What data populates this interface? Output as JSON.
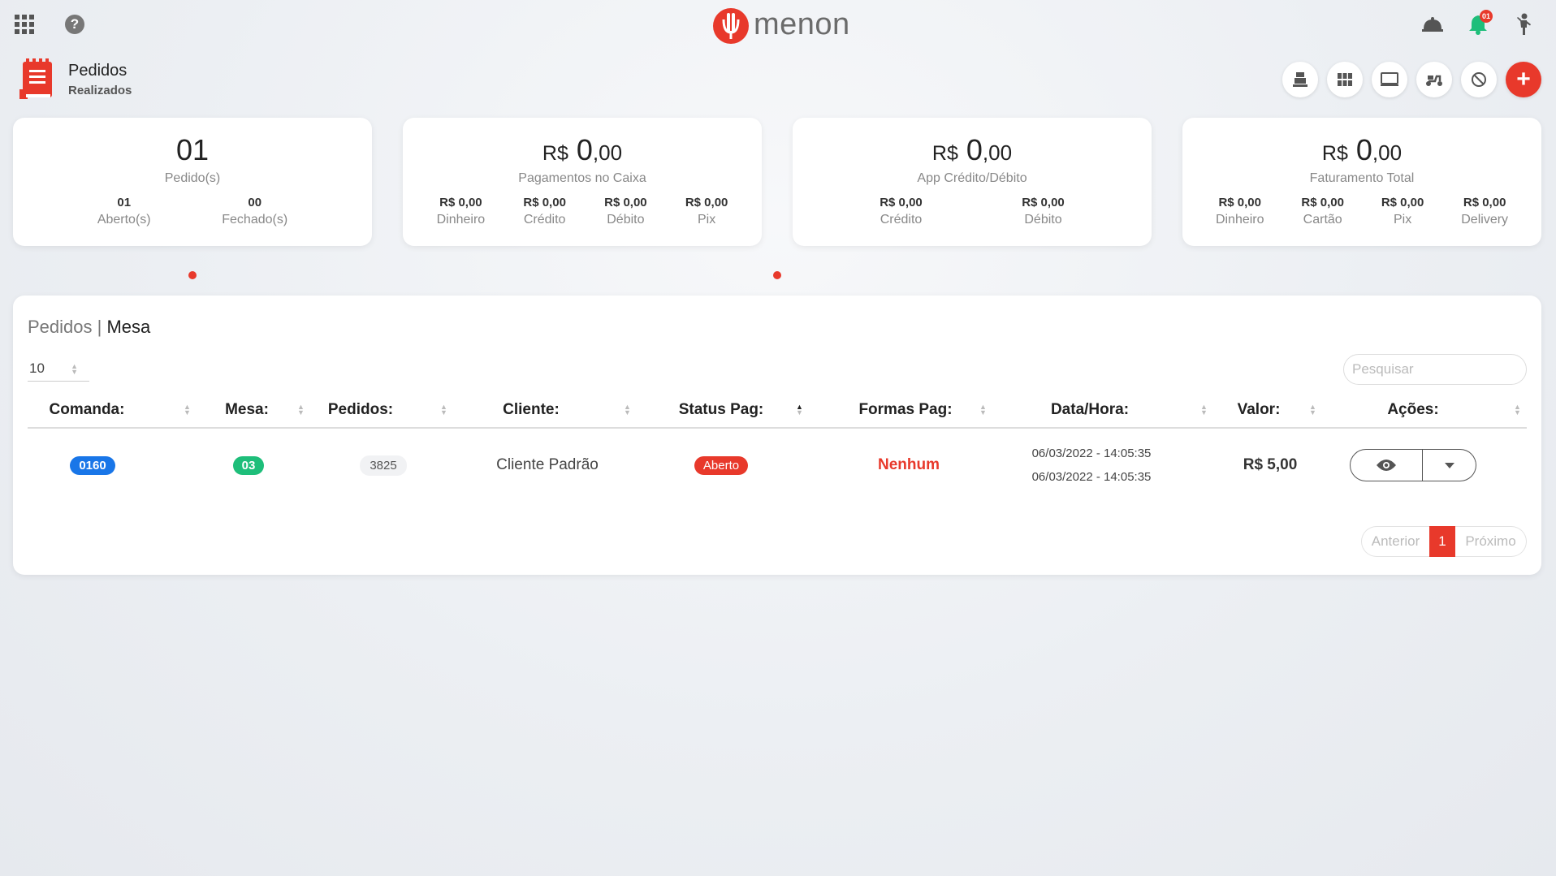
{
  "topbar": {
    "logo_text": "menon",
    "notification_count": "01",
    "icons": [
      "apps-grid-icon",
      "help-icon",
      "cloche-icon",
      "bell-icon",
      "person-icon"
    ]
  },
  "page": {
    "title": "Pedidos",
    "subtitle": "Realizados"
  },
  "colors": {
    "accent": "#e8392b",
    "blue": "#1976e8",
    "green": "#1ebe7a"
  },
  "cards": [
    {
      "main": "01",
      "label": "Pedido(s)",
      "subs": [
        {
          "value": "01",
          "label": "Aberto(s)"
        },
        {
          "value": "00",
          "label": "Fechado(s)"
        }
      ]
    },
    {
      "currency": "R$",
      "integer": "0",
      "decimal": ",00",
      "label": "Pagamentos no Caixa",
      "subs": [
        {
          "value": "R$ 0,00",
          "label": "Dinheiro"
        },
        {
          "value": "R$ 0,00",
          "label": "Crédito"
        },
        {
          "value": "R$ 0,00",
          "label": "Débito"
        },
        {
          "value": "R$ 0,00",
          "label": "Pix"
        }
      ]
    },
    {
      "currency": "R$",
      "integer": "0",
      "decimal": ",00",
      "label": "App Crédito/Débito",
      "subs": [
        {
          "value": "R$ 0,00",
          "label": "Crédito"
        },
        {
          "value": "R$ 0,00",
          "label": "Débito"
        }
      ]
    },
    {
      "currency": "R$",
      "integer": "0",
      "decimal": ",00",
      "label": "Faturamento Total",
      "subs": [
        {
          "value": "R$ 0,00",
          "label": "Dinheiro"
        },
        {
          "value": "R$ 0,00",
          "label": "Cartão"
        },
        {
          "value": "R$ 0,00",
          "label": "Pix"
        },
        {
          "value": "R$ 0,00",
          "label": "Delivery"
        }
      ]
    }
  ],
  "table": {
    "title_prefix": "Pedidos |",
    "title_main": "Mesa",
    "page_size": "10",
    "search_placeholder": "Pesquisar",
    "columns": [
      "Comanda:",
      "Mesa:",
      "Pedidos:",
      "Cliente:",
      "Status Pag:",
      "Formas Pag:",
      "Data/Hora:",
      "Valor:",
      "Ações:"
    ],
    "rows": [
      {
        "comanda": "0160",
        "mesa": "03",
        "pedidos": "3825",
        "cliente": "Cliente Padrão",
        "status": "Aberto",
        "formas": "Nenhum",
        "data1": "06/03/2022 - 14:05:35",
        "data2": "06/03/2022 - 14:05:35",
        "valor": "R$ 5,00"
      }
    ],
    "pagination": {
      "prev": "Anterior",
      "current": "1",
      "next": "Próximo"
    }
  }
}
